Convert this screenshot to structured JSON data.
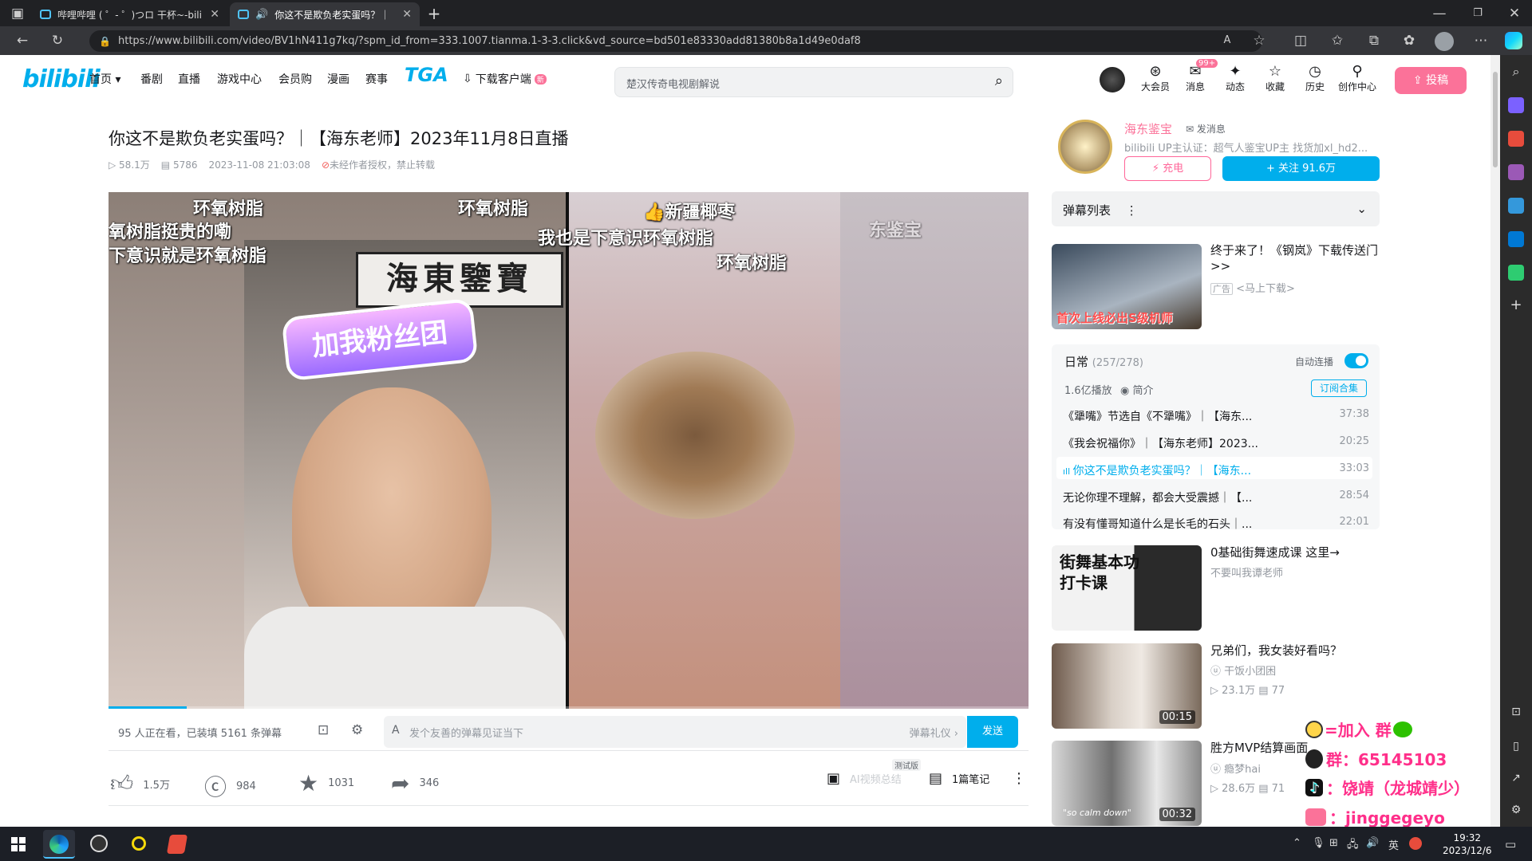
{
  "browser": {
    "tabs": [
      {
        "title": "哔哩哔哩 ( ゜- ゜)つロ 干杯~-bilili"
      },
      {
        "title": "你这不是欺负老实蛋吗？｜"
      }
    ],
    "url": "https://www.bilibili.com/video/BV1hN411g7kq/?spm_id_from=333.1007.tianma.1-3-3.click&vd_source=bd501e83330add81380b8a1d49e0daf8"
  },
  "header": {
    "logo": "bilibili",
    "nav": [
      "首页 ▾",
      "番剧",
      "直播",
      "游戏中心",
      "会员购",
      "漫画",
      "赛事"
    ],
    "tga": "TGA",
    "download": "下载客户端",
    "download_badge": "新",
    "search_placeholder": "楚汉传奇电视剧解说",
    "icons": [
      {
        "label": "大会员",
        "icon": "vip-icon"
      },
      {
        "label": "消息",
        "icon": "message-icon",
        "badge": "99+"
      },
      {
        "label": "动态",
        "icon": "dynamic-icon"
      },
      {
        "label": "收藏",
        "icon": "star-icon"
      },
      {
        "label": "历史",
        "icon": "history-icon"
      },
      {
        "label": "创作中心",
        "icon": "creator-icon"
      }
    ],
    "upload": "投稿"
  },
  "video": {
    "title": "你这不是欺负老实蛋吗？｜【海东老师】2023年11月8日直播",
    "views": "58.1万",
    "danmaku_count": "5786",
    "date": "2023-11-08 21:03:08",
    "copyright": "未经作者授权，禁止转载",
    "danmaku": [
      "环氧树脂",
      "氧树脂挺贵的嘞",
      "下意识就是环氧树脂",
      "环氧树脂",
      "👍新疆椰枣",
      "我也是下意识环氧树脂",
      "环氧树脂",
      "东鉴宝"
    ],
    "sign_text": "海東鑒寶",
    "fan_badge": "加我粉丝团"
  },
  "danmaku_bar": {
    "watching": "95 人正在看，已装填 5161 条弹幕",
    "placeholder": "发个友善的弹幕见证当下",
    "etiquette": "弹幕礼仪 ›",
    "send": "发送"
  },
  "actions": {
    "like": "1.5万",
    "coin": "984",
    "favorite": "1031",
    "share": "346",
    "ai_summary": "AI视频总结",
    "ai_badge": "测试版",
    "notes": "1篇笔记"
  },
  "uploader": {
    "name": "海东鉴宝",
    "message": "发消息",
    "desc": "bilibili UP主认证：超气人鉴宝UP主 找货加xl_hd2...",
    "charge": "充电",
    "follow": "+ 关注 91.6万"
  },
  "danmaku_list": {
    "title": "弹幕列表"
  },
  "ad": {
    "title": "终于来了！《钢岚》下载传送门>>",
    "tag": "广告",
    "sub": "<马上下载>",
    "thumb_text": "首次上线必出S级机师"
  },
  "series": {
    "title": "日常",
    "progress": "(257/278)",
    "autoplay": "自动连播",
    "plays": "1.6亿播放",
    "intro": "简介",
    "subscribe": "订阅合集",
    "items": [
      {
        "title": "《犟嘴》节选自《不犟嘴》｜【海东...",
        "dur": "37:38"
      },
      {
        "title": "《我会祝福你》｜【海东老师】2023...",
        "dur": "20:25"
      },
      {
        "title": "你这不是欺负老实蛋吗？｜【海东...",
        "dur": "33:03"
      },
      {
        "title": "无论你理不理解，都会大受震撼｜【...",
        "dur": "28:54"
      },
      {
        "title": "有没有懂哥知道什么是长毛的石头｜...",
        "dur": "22:01"
      }
    ]
  },
  "recommend": [
    {
      "title": "0基础街舞速成课 这里→",
      "up": "不要叫我谭老师",
      "thumb_text": "街舞基本功打卡课"
    },
    {
      "title": "兄弟们，我女装好看吗？",
      "up": "干饭小团困",
      "views": "23.1万",
      "comments": "77",
      "duration": "00:15"
    },
    {
      "title": "胜方MVP结算画面",
      "up": "瘾梦hai",
      "views": "28.6万",
      "comments": "71",
      "duration": "00:32",
      "thumb_text": "\"so calm down\""
    }
  ],
  "overlay": {
    "line1": "=加入   群",
    "line2": "群：65145103",
    "line3": "：饶靖（龙城靖少）",
    "line4": "：jinggegeyo"
  },
  "taskbar": {
    "time": "19:32",
    "date": "2023/12/6",
    "ime": "英"
  }
}
